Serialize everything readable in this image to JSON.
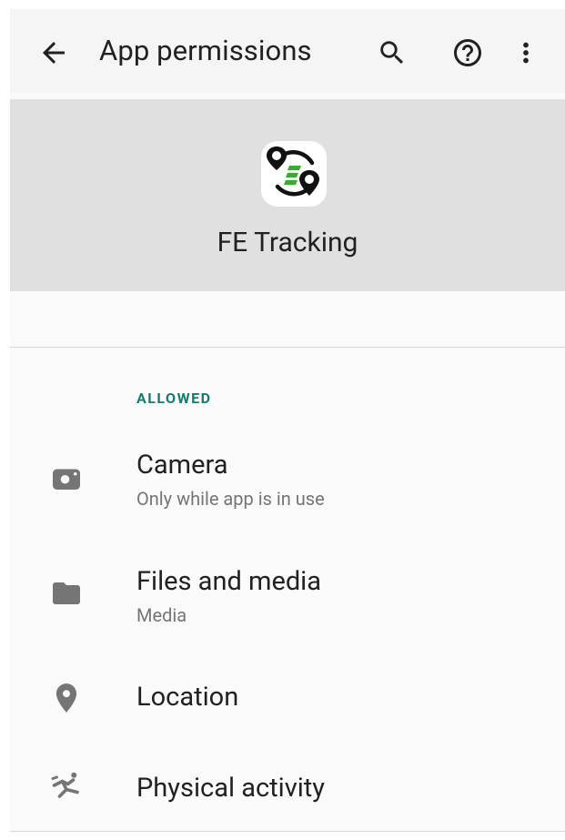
{
  "toolbar": {
    "title": "App permissions",
    "back_icon": "arrow-back-icon",
    "search_icon": "search-icon",
    "help_icon": "help-circle-icon",
    "more_icon": "more-vert-icon"
  },
  "app": {
    "name": "FE Tracking",
    "icon": "app-logo-icon",
    "brand_green": "#3aa935"
  },
  "section": {
    "title": "ALLOWED",
    "color": "#137e6d"
  },
  "permissions": [
    {
      "label": "Camera",
      "summary": "Only while app is in use",
      "icon": "camera-icon"
    },
    {
      "label": "Files and media",
      "summary": "Media",
      "icon": "folder-icon"
    },
    {
      "label": "Location",
      "summary": "",
      "icon": "location-pin-icon"
    },
    {
      "label": "Physical activity",
      "summary": "",
      "icon": "physical-activity-icon"
    }
  ],
  "colors": {
    "toolbar_bg": "#f5f5f5",
    "header_bg": "#e0e0e0",
    "icon_gray": "#757575"
  }
}
